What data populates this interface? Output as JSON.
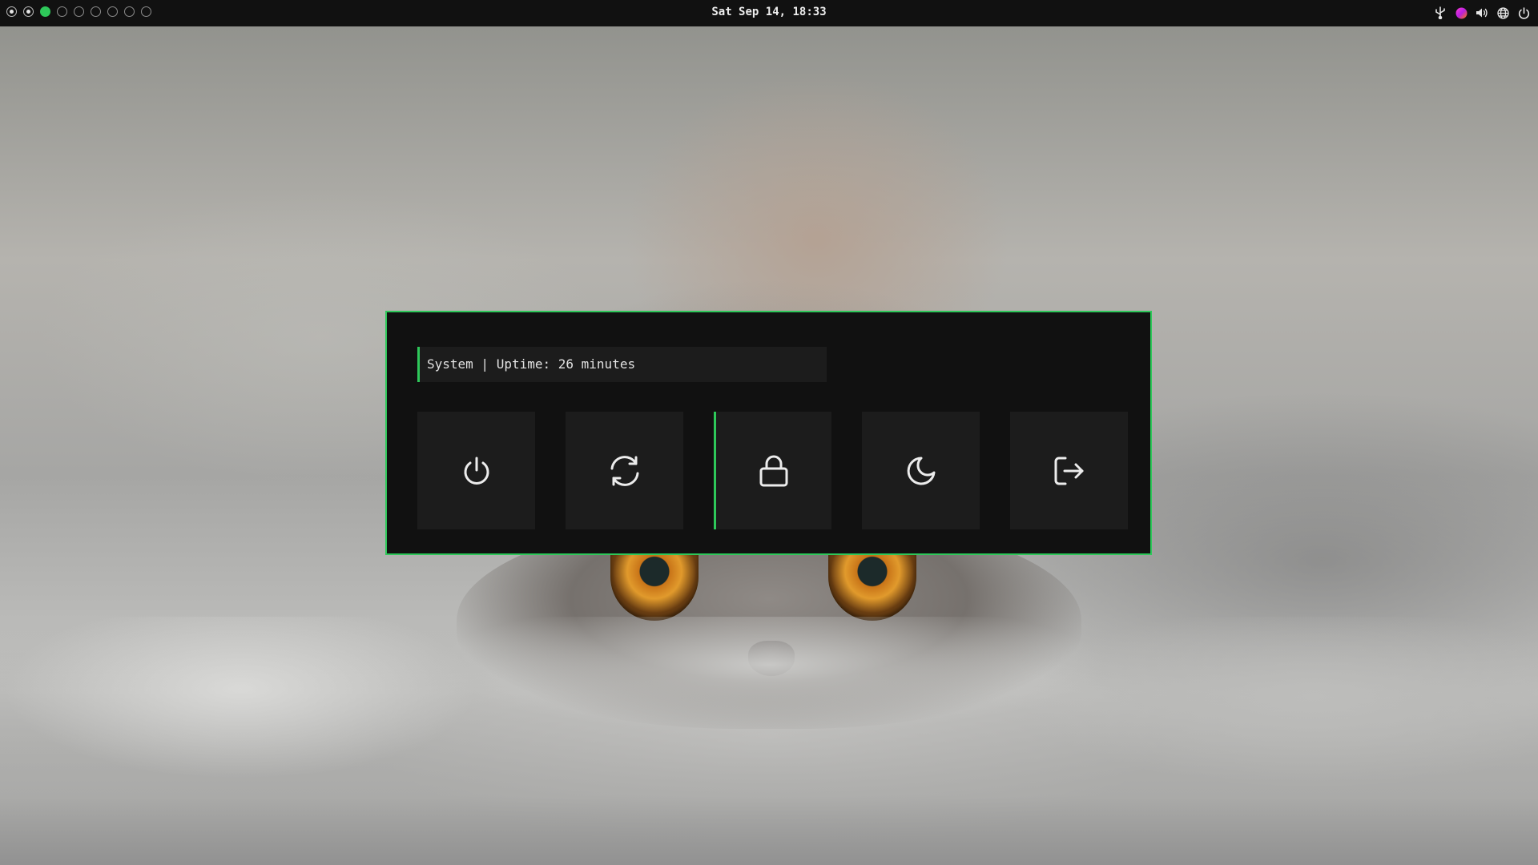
{
  "topbar": {
    "clock": "Sat Sep 14, 18:33",
    "workspaces": [
      {
        "id": 1,
        "state": "occupied"
      },
      {
        "id": 2,
        "state": "occupied"
      },
      {
        "id": 3,
        "state": "active"
      },
      {
        "id": 4,
        "state": "empty"
      },
      {
        "id": 5,
        "state": "empty"
      },
      {
        "id": 6,
        "state": "empty"
      },
      {
        "id": 7,
        "state": "empty"
      },
      {
        "id": 8,
        "state": "empty"
      },
      {
        "id": 9,
        "state": "empty"
      }
    ],
    "tray_icons": [
      "usb-icon",
      "color-picker-icon",
      "volume-icon",
      "network-globe-icon",
      "power-icon"
    ]
  },
  "power_menu": {
    "prompt": "System | Uptime: 26 minutes",
    "options": [
      {
        "name": "shutdown",
        "icon": "power-icon"
      },
      {
        "name": "reboot",
        "icon": "reboot-icon"
      },
      {
        "name": "lock",
        "icon": "lock-icon",
        "selected": true
      },
      {
        "name": "suspend",
        "icon": "moon-icon"
      },
      {
        "name": "logout",
        "icon": "logout-icon"
      }
    ]
  },
  "colors": {
    "accent": "#2ec85a",
    "panel_bg": "#111111",
    "button_bg": "#1c1c1c",
    "text": "#e2e2e2"
  },
  "wallpaper": {
    "subject": "grey cat peeking over a blanket"
  }
}
